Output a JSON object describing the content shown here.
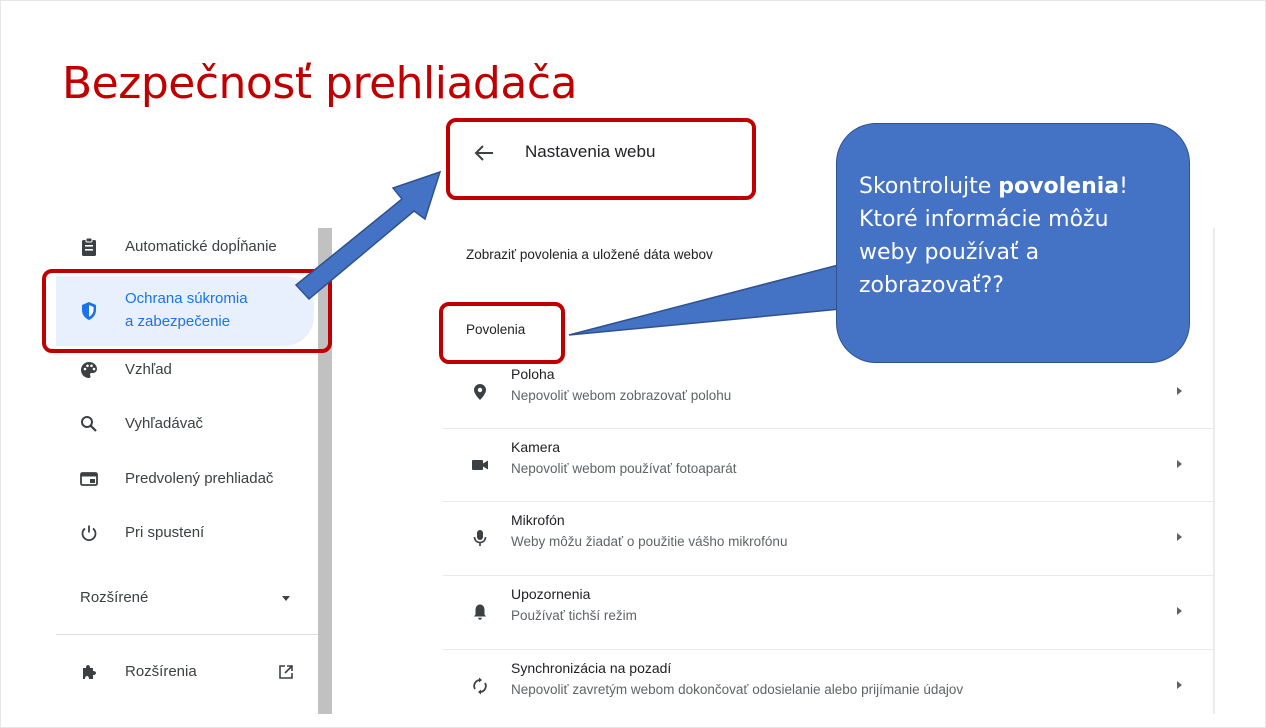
{
  "slide": {
    "title": "Bezpečnosť prehliadača"
  },
  "sidebar": {
    "items": [
      {
        "label": "Automatické dopĺňanie",
        "icon": "clipboard-icon"
      },
      {
        "label_line1": "Ochrana súkromia",
        "label_line2": "a zabezpečenie",
        "icon": "shield-icon",
        "active": true
      },
      {
        "label": "Vzhľad",
        "icon": "palette-icon"
      },
      {
        "label": "Vyhľadávač",
        "icon": "search-icon"
      },
      {
        "label": "Predvolený prehliadač",
        "icon": "browser-window-icon"
      },
      {
        "label": "Pri spustení",
        "icon": "power-icon"
      }
    ],
    "advanced_label": "Rozšírené",
    "extensions_label": "Rozšírenia"
  },
  "panel": {
    "header_title": "Nastavenia webu",
    "section_desc": "Zobraziť povolenia a uložené dáta webov",
    "section_label": "Povolenia",
    "permissions": [
      {
        "title": "Poloha",
        "subtitle": "Nepovoliť webom zobrazovať polohu",
        "icon": "location-pin-icon"
      },
      {
        "title": "Kamera",
        "subtitle": "Nepovoliť webom používať fotoaparát",
        "icon": "camera-icon"
      },
      {
        "title": "Mikrofón",
        "subtitle": "Weby môžu žiadať o použitie vášho mikrofónu",
        "icon": "microphone-icon"
      },
      {
        "title": "Upozornenia",
        "subtitle": "Používať tichší režim",
        "icon": "bell-icon"
      },
      {
        "title": "Synchronizácia na pozadí",
        "subtitle": "Nepovoliť zavretým webom dokončovať odosielanie alebo prijímanie údajov",
        "icon": "sync-icon"
      }
    ]
  },
  "callout": {
    "line1_pre": "Skontrolujte ",
    "line1_bold": "povolenia",
    "line1_post": "!",
    "line2": "Ktoré informácie môžu",
    "line3": "weby používať a",
    "line4": "zobrazovať??"
  },
  "colors": {
    "accent_red": "#c00000",
    "callout_blue": "#4472c4",
    "chrome_blue": "#1a73e8"
  }
}
